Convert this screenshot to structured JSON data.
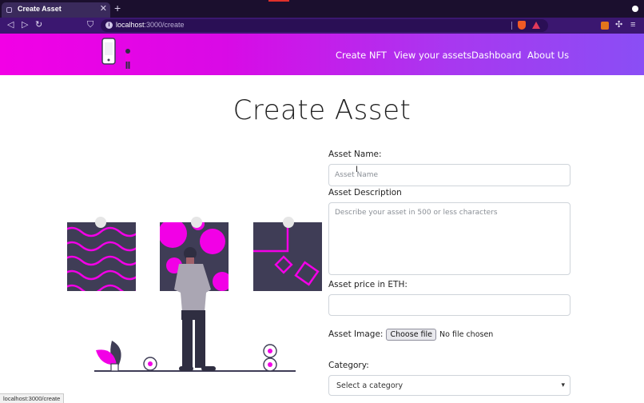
{
  "browser": {
    "tab_title": "Create Asset",
    "tab_close": "✕",
    "new_tab": "+",
    "url_host": "localhost",
    "url_path": ":3000/create",
    "back": "◁",
    "forward": "▷",
    "reload": "↻",
    "bookmark": "⛉",
    "info": "i",
    "puzzle": "✣",
    "menu": "≡",
    "status_url": "localhost:3000/create"
  },
  "header": {
    "nav": [
      "Create NFT",
      "View your assets",
      "Dashboard",
      "About Us"
    ],
    "gradient": [
      "#f200e6",
      "#8a4ef5"
    ]
  },
  "page": {
    "title": "Create Asset"
  },
  "form": {
    "name_label": "Asset Name:",
    "name_placeholder": "Asset Name",
    "description_label": "Asset Description",
    "description_placeholder": "Describe your asset in 500 or less characters",
    "price_label": "Asset price in ETH:",
    "price_value": "",
    "image_label": "Asset Image:",
    "file_button": "Choose file",
    "file_status": "No file chosen",
    "category_label": "Category:",
    "category_selected": "Select a category",
    "category_caret": "▾"
  },
  "colors": {
    "accent": "#f200e6",
    "art_dark": "#3f3d56",
    "shirt": "#aaa6b3"
  }
}
